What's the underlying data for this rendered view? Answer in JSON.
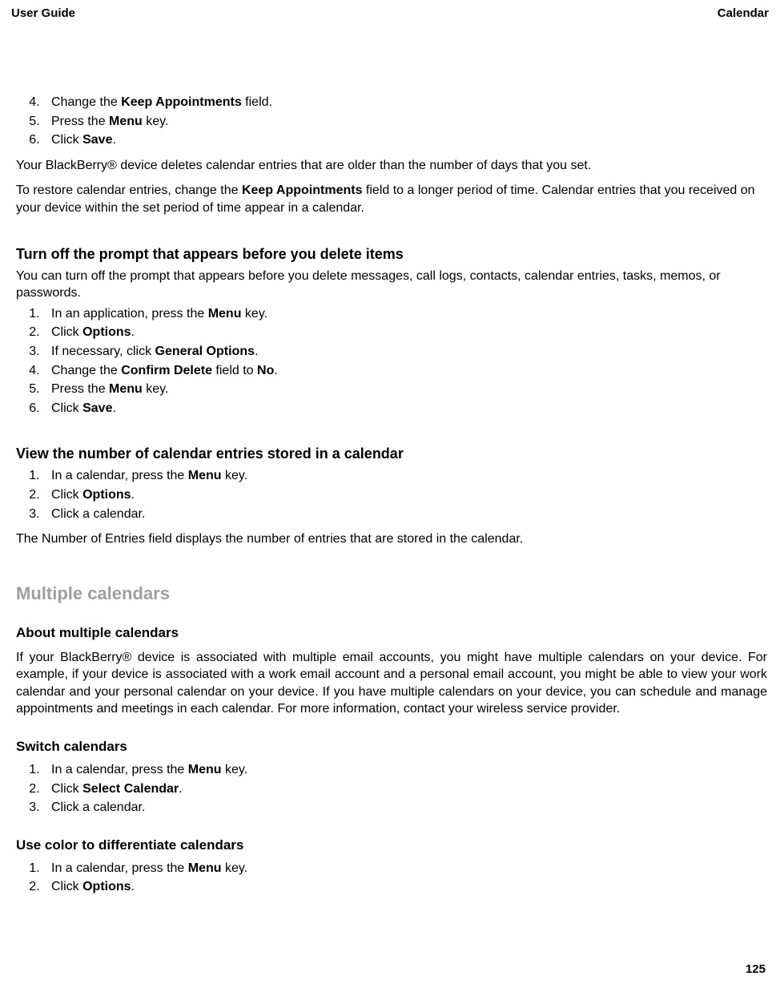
{
  "header": {
    "left": "User Guide",
    "right": "Calendar"
  },
  "intro_list": {
    "start": 4,
    "items": [
      {
        "pre": "Change the ",
        "bold": "Keep Appointments",
        "post": " field."
      },
      {
        "pre": "Press the ",
        "bold": "Menu",
        "post": " key."
      },
      {
        "pre": "Click ",
        "bold": "Save",
        "post": "."
      }
    ]
  },
  "intro_para1": "Your BlackBerry® device deletes calendar entries that are older than the number of days that you set.",
  "intro_para2": {
    "pre": "To restore calendar entries, change the ",
    "bold": "Keep Appointments",
    "post": " field to a longer period of time. Calendar entries that you received on your device within the set period of time appear in a calendar."
  },
  "sec1": {
    "title": "Turn off the prompt that appears before you delete items",
    "intro": "You can turn off the prompt that appears before you delete messages, call logs, contacts, calendar entries, tasks, memos, or passwords.",
    "items": [
      {
        "pre": "In an application, press the ",
        "bold": "Menu",
        "post": " key."
      },
      {
        "pre": "Click ",
        "bold": "Options",
        "post": "."
      },
      {
        "pre": "If necessary, click ",
        "bold": "General Options",
        "post": "."
      },
      {
        "pre": "Change the ",
        "bold": "Confirm Delete",
        "post": " field to ",
        "bold2": "No",
        "post2": "."
      },
      {
        "pre": "Press the ",
        "bold": "Menu",
        "post": " key."
      },
      {
        "pre": "Click ",
        "bold": "Save",
        "post": "."
      }
    ]
  },
  "sec2": {
    "title": "View the number of calendar entries stored in a calendar",
    "items": [
      {
        "pre": "In a calendar, press the ",
        "bold": "Menu",
        "post": " key."
      },
      {
        "pre": "Click ",
        "bold": "Options",
        "post": "."
      },
      {
        "pre": "Click a calendar.",
        "bold": "",
        "post": ""
      }
    ],
    "after": "The Number of Entries field displays the number of entries that are stored in the calendar."
  },
  "major": {
    "title": "Multiple calendars"
  },
  "sub1": {
    "title": "About multiple calendars",
    "para": "If your BlackBerry® device is associated with multiple email accounts, you might have multiple calendars on your device. For example, if your device is associated with a work email account and a personal email account, you might be able to view your work calendar and your personal calendar on your device. If you have multiple calendars on your device, you can schedule and manage appointments and meetings in each calendar. For more information, contact your wireless service provider."
  },
  "sub2": {
    "title": "Switch calendars",
    "items": [
      {
        "pre": "In a calendar, press the ",
        "bold": "Menu",
        "post": " key."
      },
      {
        "pre": "Click ",
        "bold": "Select Calendar",
        "post": "."
      },
      {
        "pre": "Click a calendar.",
        "bold": "",
        "post": ""
      }
    ]
  },
  "sub3": {
    "title": "Use color to differentiate calendars",
    "items": [
      {
        "pre": "In a calendar, press the ",
        "bold": "Menu",
        "post": " key."
      },
      {
        "pre": "Click ",
        "bold": "Options",
        "post": "."
      }
    ]
  },
  "page_number": "125"
}
